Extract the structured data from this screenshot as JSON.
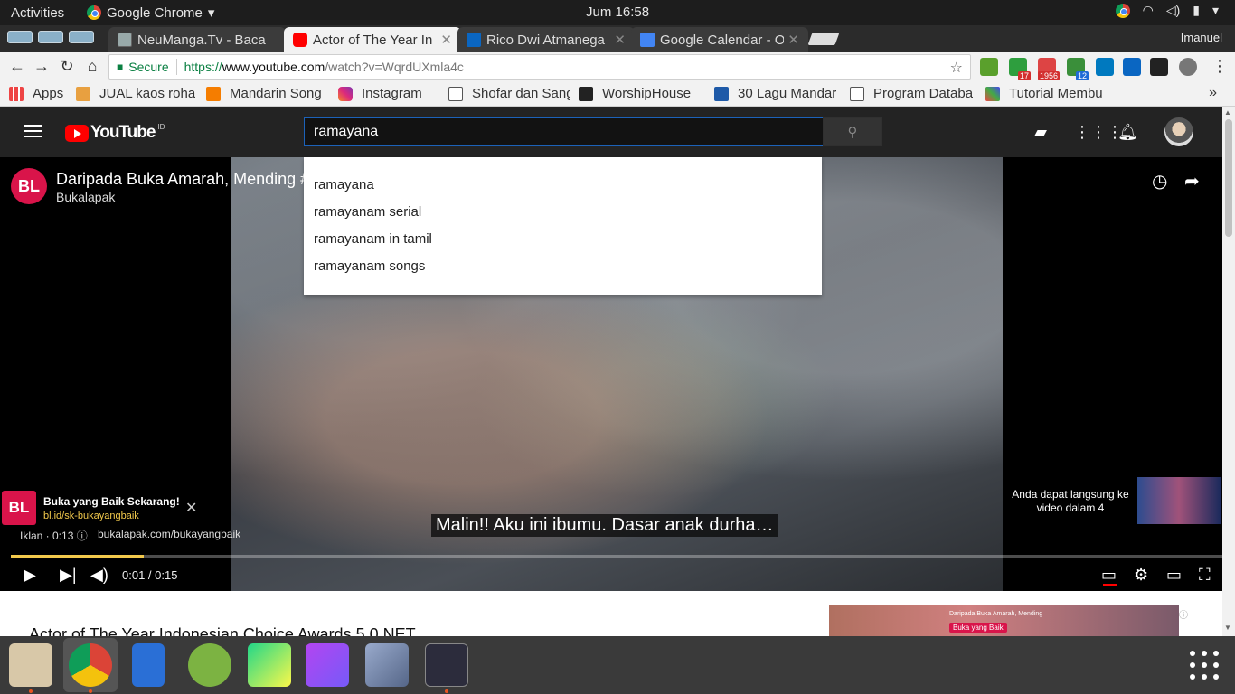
{
  "system": {
    "activities": "Activities",
    "app_name": "Google Chrome",
    "clock": "Jum 16:58"
  },
  "browser": {
    "profile_name": "Imanuel",
    "tabs": [
      {
        "title": "NeuManga.Tv - Baca",
        "active": false
      },
      {
        "title": "Actor of The Year In",
        "active": true
      },
      {
        "title": "Rico Dwi Atmanega",
        "active": false
      },
      {
        "title": "Google Calendar - O",
        "active": false
      }
    ],
    "secure_label": "Secure",
    "url_scheme": "https://",
    "url_host": "www.youtube.com",
    "url_path": "/watch?v=WqrdUXmla4c",
    "extension_badges": {
      "badge1": "17",
      "badge2": "1956",
      "badge3": "12"
    },
    "bookmarks": [
      "Apps",
      "JUAL kaos roha",
      "Mandarin Song",
      "Instagram",
      "Shofar dan Sang",
      "WorshipHouse",
      "30 Lagu Mandar",
      "Program Databa",
      "Tutorial Membu"
    ]
  },
  "youtube": {
    "logo_text": "YouTube",
    "country": "ID",
    "search_value": "ramayana",
    "suggestions": [
      "ramayana",
      "ramayanam serial",
      "ramayanam in tamil",
      "ramayanam songs"
    ]
  },
  "player": {
    "channel_logo": "BL",
    "title": "Daripada Buka Amarah, Mending #",
    "channel": "Bukalapak",
    "ad_headline": "Buka yang Baik Sekarang!",
    "ad_url": "bl.id/sk-bukayangbaik",
    "ad_info": "Iklan · 0:13",
    "ad_site": "bukalapak.com/bukayangbaik",
    "subtitle": "Malin!! Aku ini ibumu. Dasar anak durha…",
    "skip_text": "Anda dapat langsung ke video dalam 4",
    "time_current": "0:01",
    "time_total": "0:15",
    "time_display": "0:01 / 0:15",
    "progress_fraction": 0.11
  },
  "page": {
    "video_title": "Actor of The Year Indonesian Choice Awards 5.0 NET",
    "side_ad_title": "Daripada Buka Amarah, Mending",
    "side_ad_button": "Buka yang Baik"
  },
  "colors": {
    "yt_red": "#ff0000",
    "bukalapak": "#d9144a",
    "ad_yellow": "#f2c94c"
  }
}
